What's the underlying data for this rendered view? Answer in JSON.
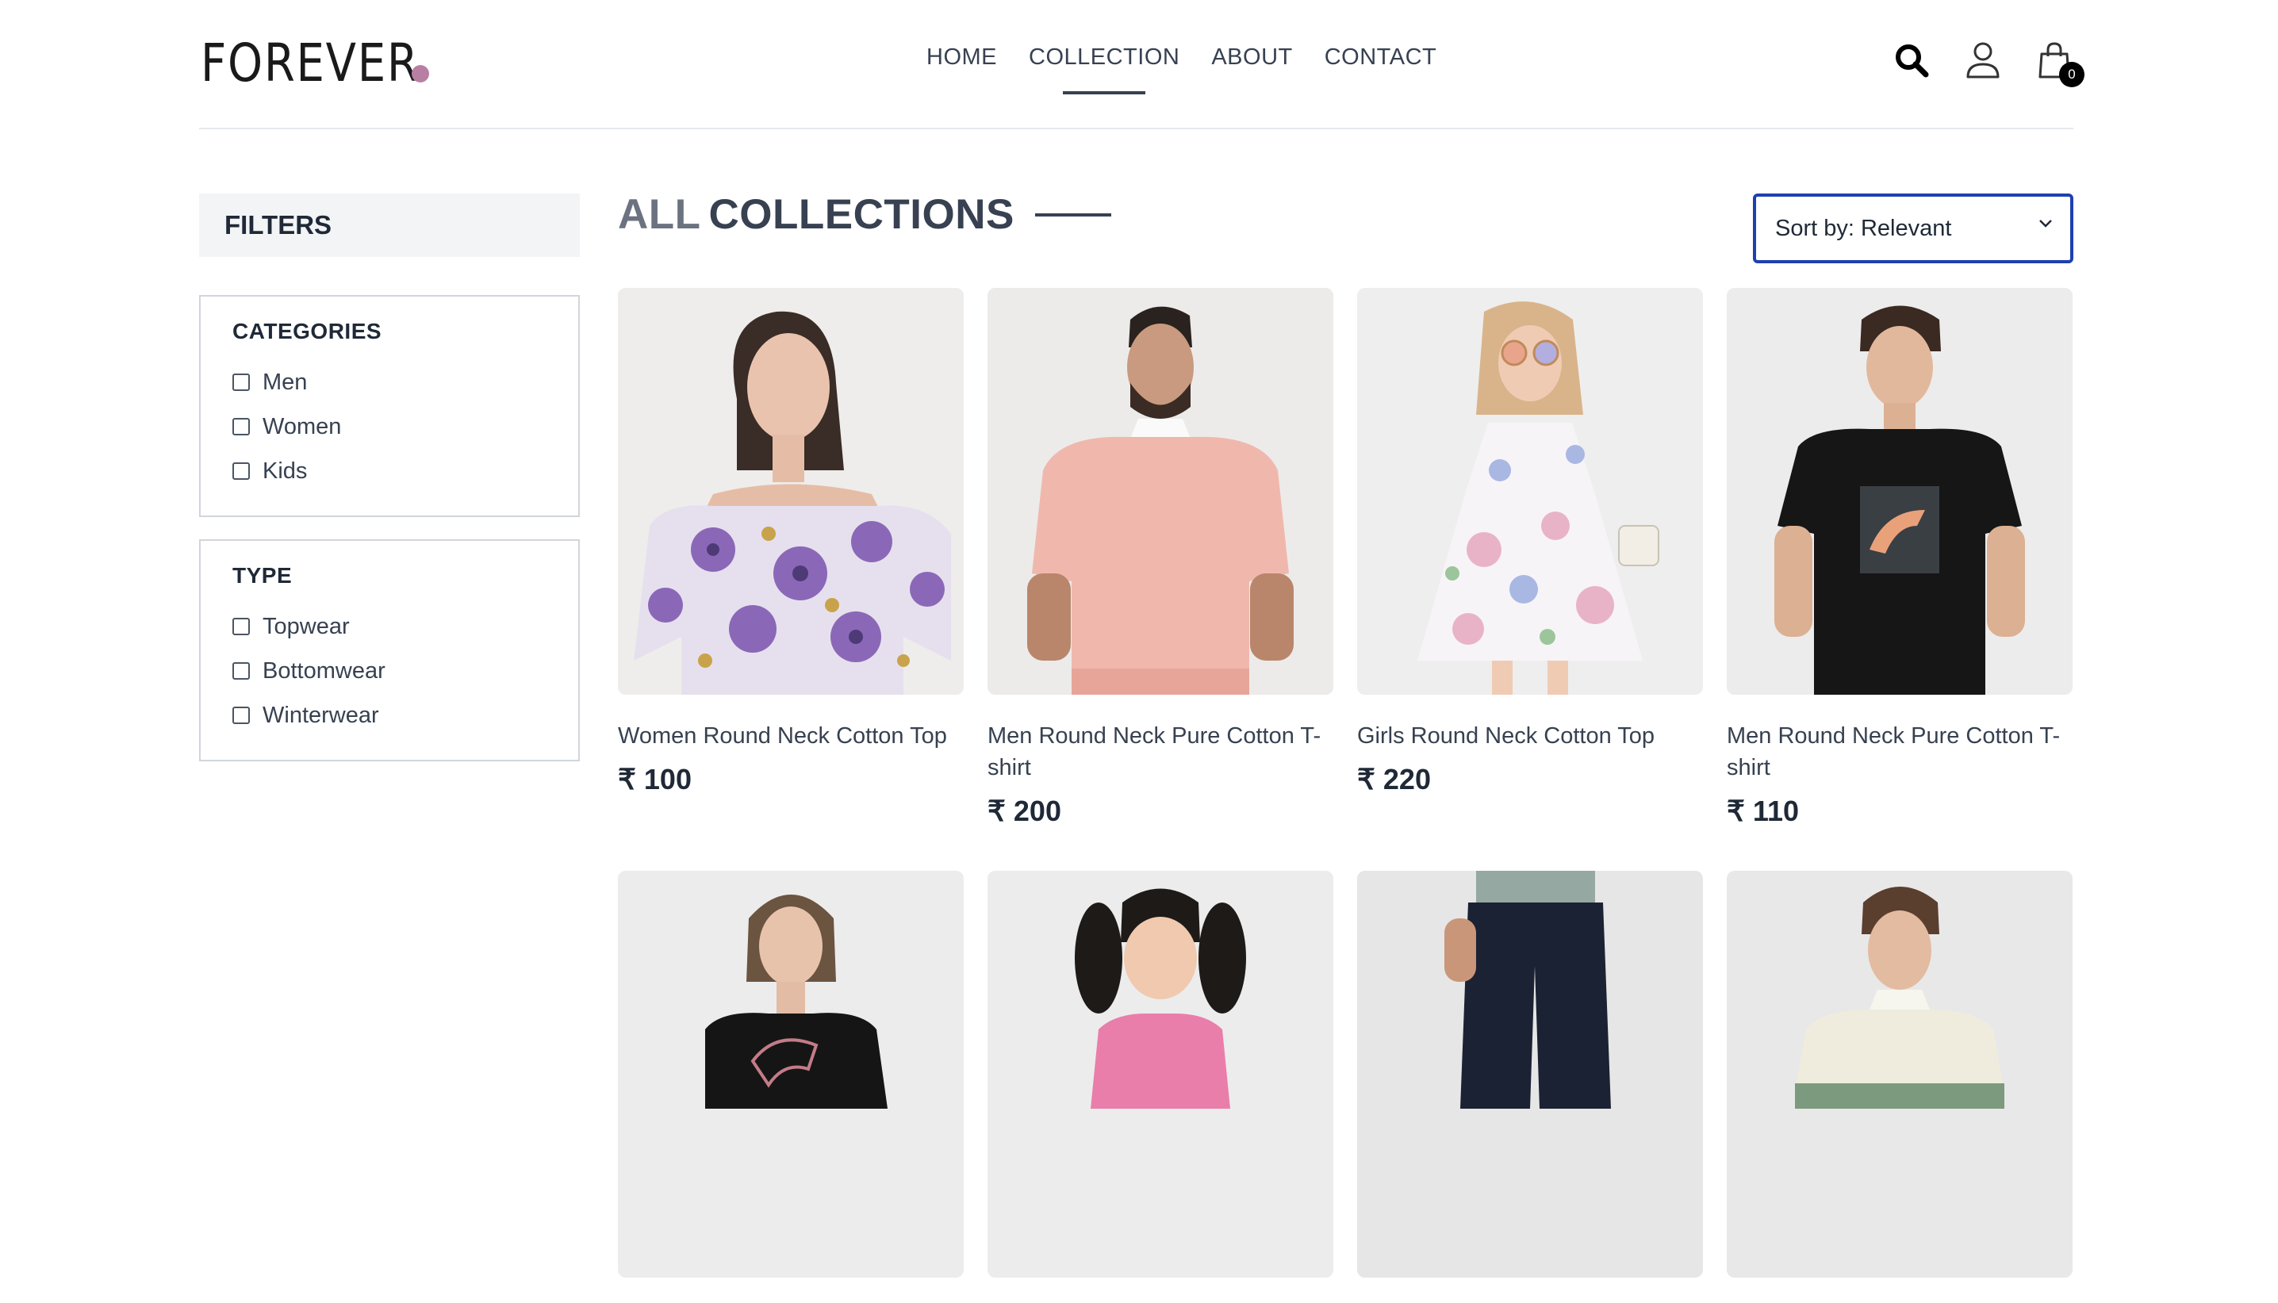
{
  "brand": {
    "name": "FOREVER",
    "dot_color": "#b97fa2"
  },
  "nav": {
    "items": [
      {
        "label": "HOME"
      },
      {
        "label": "COLLECTION"
      },
      {
        "label": "ABOUT"
      },
      {
        "label": "CONTACT"
      }
    ],
    "active": "COLLECTION"
  },
  "header_icons": {
    "search": "search-icon",
    "profile": "user-icon",
    "cart": "shopping-bag-icon",
    "cart_count": "0"
  },
  "filters": {
    "title": "FILTERS",
    "categories": {
      "heading": "CATEGORIES",
      "options": [
        "Men",
        "Women",
        "Kids"
      ]
    },
    "type": {
      "heading": "TYPE",
      "options": [
        "Topwear",
        "Bottomwear",
        "Winterwear"
      ]
    }
  },
  "collection": {
    "title_part1": "ALL",
    "title_part2": "COLLECTIONS",
    "sort_label": "Sort by: Relevant"
  },
  "products": [
    {
      "name": "Women Round Neck Cotton Top",
      "price": "₹ 100"
    },
    {
      "name": "Men Round Neck Pure Cotton T-shirt",
      "price": "₹ 200"
    },
    {
      "name": "Girls Round Neck Cotton Top",
      "price": "₹ 220"
    },
    {
      "name": "Men Round Neck Pure Cotton T-shirt",
      "price": "₹ 110"
    },
    {
      "name": "",
      "price": ""
    },
    {
      "name": "",
      "price": ""
    },
    {
      "name": "",
      "price": ""
    },
    {
      "name": "",
      "price": ""
    }
  ],
  "colors": {
    "accent_border": "#1e40af",
    "text_dark": "#1f2937",
    "muted": "#6b7280"
  }
}
